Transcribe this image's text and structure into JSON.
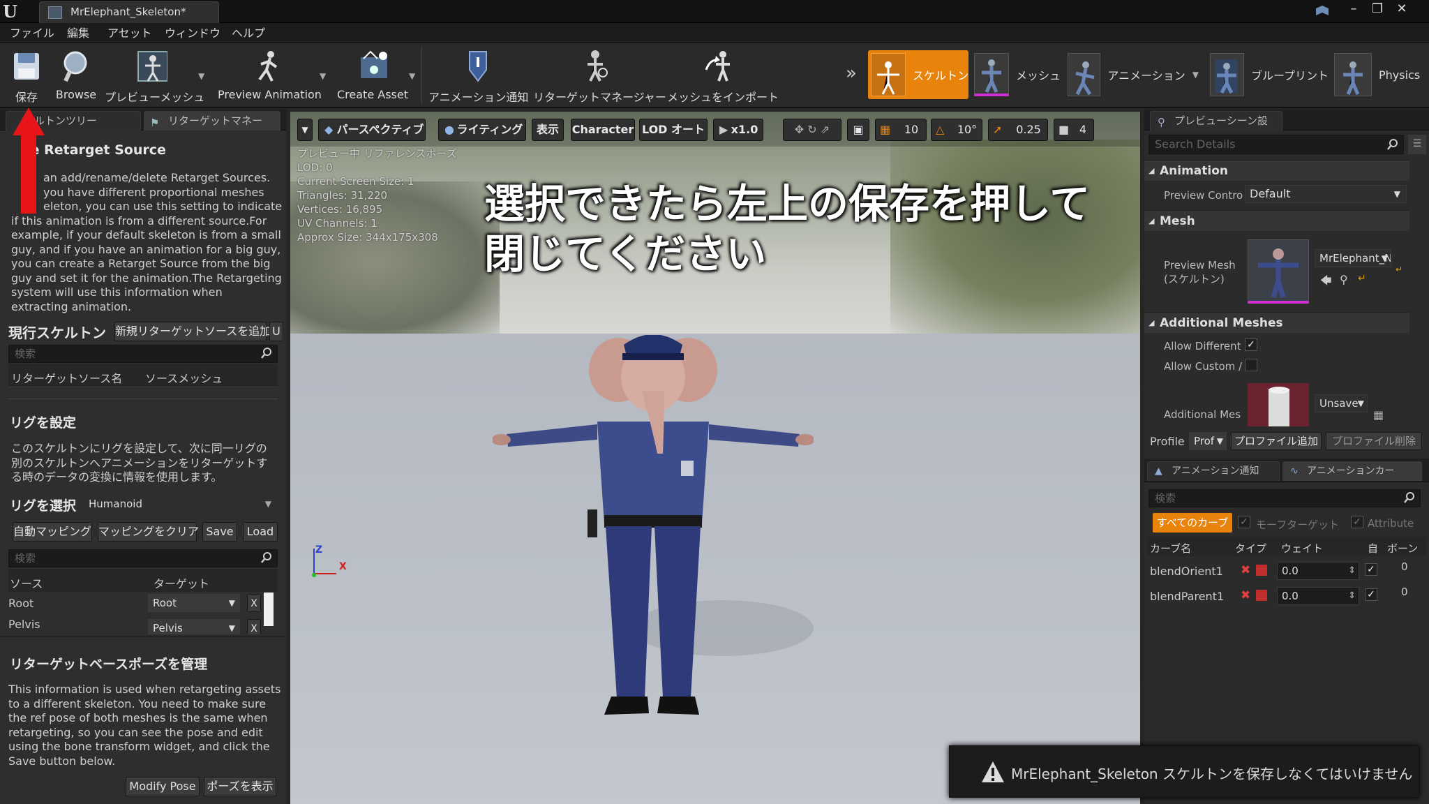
{
  "window": {
    "tab_title": "MrElephant_Skeleton*",
    "logo": "U",
    "buttons": [
      "minimize-icon",
      "restore-icon",
      "close-icon"
    ]
  },
  "menu": [
    "ファイル",
    "編集",
    "アセット",
    "ウィンドウ",
    "ヘルプ"
  ],
  "toolbar": {
    "save": "保存",
    "browse": "Browse",
    "preview_mesh": "プレビューメッシュ",
    "preview_animation": "Preview Animation",
    "create_asset": "Create Asset",
    "anim_notify": "アニメーション通知",
    "retarget_manager": "リターゲットマネージャー",
    "import_mesh": "メッシュをインポート",
    "modes": [
      "スケルトン",
      "メッシュ",
      "アニメーション",
      "ブループリント",
      "Physics"
    ]
  },
  "left": {
    "tabs": [
      "ルトンツリー",
      "リターゲットマネー"
    ],
    "retarget_title": "ge Retarget Source",
    "retarget_lines": [
      "an add/rename/delete Retarget Sources.",
      "you have different proportional meshes",
      "eleton, you can use this setting to indicate",
      "if this animation is from a different source.For",
      "example, if your default skeleton is from a small",
      "guy, and if you have an animation for a big guy,",
      "you can create a Retarget Source from the big",
      "guy and set it for the animation.The Retargeting",
      "system will use this information when",
      "extracting animation."
    ],
    "current_skeleton": "現行スケルトン",
    "add_retarget_source": "新規リターゲットソースを追加",
    "u_button": "U",
    "search_placeholder": "検索",
    "col_source_name": "リターゲットソース名",
    "col_source_mesh": "ソースメッシュ",
    "rig_setup_title": "リグを設定",
    "rig_setup_lines": [
      "このスケルトンにリグを設定して、次に同一リグの",
      "別のスケルトンへアニメーションをリターゲットす",
      "る時のデータの変換に情報を使用します。"
    ],
    "select_rig": "リグを選択",
    "rig_value": "Humanoid",
    "auto_map": "自動マッピング",
    "clear_map": "マッピングをクリア",
    "save": "Save",
    "load": "Load",
    "search2_placeholder": "検索",
    "col_source": "ソース",
    "col_target": "ターゲット",
    "rows": [
      {
        "source": "Root",
        "target": "Root"
      },
      {
        "source": "Pelvis",
        "target": "Pelvis"
      }
    ],
    "x_label": "X",
    "base_pose_title": "リターゲットベースポーズを管理",
    "base_pose_lines": [
      "This information is used when retargeting assets",
      "to a different skeleton. You need to make sure",
      "the ref pose of both meshes is the same when",
      "retargeting, so you can see the pose and edit",
      "using the bone transform widget, and click the",
      "Save button below."
    ],
    "modify_pose": "Modify Pose",
    "show_pose": "ポーズを表示"
  },
  "viewport": {
    "buttons": [
      "パースペクティブ",
      "ライティング",
      "表示",
      "Character",
      "LOD オート",
      "x1.0"
    ],
    "snap_values": [
      "10",
      "10°",
      "0.25",
      "4"
    ],
    "stats": [
      "プレビュー中 リファレンスポーズ",
      "LOD: 0",
      "Current Screen Size: 1",
      "Triangles: 31,220",
      "Vertices: 16,895",
      "UV Channels: 1",
      "Approx Size: 344x175x308"
    ],
    "overlay_line1": "選択できたら左上の保存を押して",
    "overlay_line2": "閉じてください",
    "axis_z": "Z",
    "axis_x": "X"
  },
  "right": {
    "tab": "プレビューシーン設",
    "search_placeholder": "Search Details",
    "cat_animation": "Animation",
    "preview_controller_label": "Preview Contro",
    "preview_controller_value": "Default",
    "cat_mesh": "Mesh",
    "preview_mesh_label": "Preview Mesh",
    "preview_mesh_sub": "(スケルトン)",
    "preview_mesh_value": "MrElephant_N",
    "cat_additional": "Additional Meshes",
    "allow_different": "Allow Different",
    "allow_custom": "Allow Custom /",
    "additional_mes": "Additional Mes",
    "additional_value": "Unsave",
    "profile_label": "Profile",
    "profile_value": "Prof",
    "add_profile": "プロファイル追加",
    "delete_profile": "プロファイル削除",
    "curve_tabs": [
      "アニメーション通知",
      "アニメーションカー"
    ],
    "curve_search": "検索",
    "filter_all": "すべてのカーブ",
    "filter_morph": "モーフターゲット",
    "filter_attr": "Attribute",
    "col_curve": "カーブ名",
    "col_type": "タイプ",
    "col_weight": "ウェイト",
    "col_auto": "自",
    "col_bone": "ボーン",
    "curves": [
      {
        "name": "blendOrient1",
        "weight": "0.0",
        "bone": "0"
      },
      {
        "name": "blendParent1",
        "weight": "0.0",
        "bone": "0"
      }
    ]
  },
  "toast": {
    "text": "MrElephant_Skeleton スケルトンを保存しなくてはいけません"
  },
  "colors": {
    "accent_orange": "#e8840c",
    "arrow_red": "#e8141a"
  }
}
